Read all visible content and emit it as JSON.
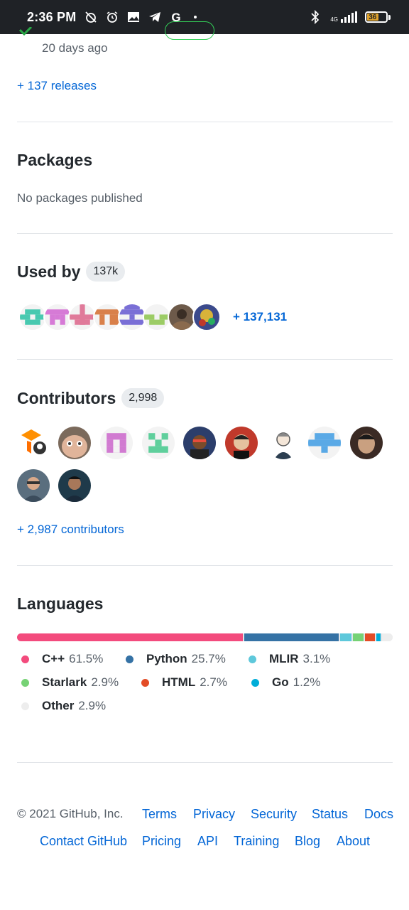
{
  "status_bar": {
    "time": "2:36 PM",
    "network": "4G",
    "battery": "36"
  },
  "releases": {
    "latest_time": "20 days ago",
    "more_link": "+ 137 releases"
  },
  "packages": {
    "title": "Packages",
    "empty_text": "No packages published"
  },
  "used_by": {
    "title": "Used by",
    "count": "137k",
    "more": "+ 137,131"
  },
  "contributors": {
    "title": "Contributors",
    "count": "2,998",
    "more": "+ 2,987 contributors"
  },
  "languages": {
    "title": "Languages",
    "items": [
      {
        "name": "C++",
        "percent": "61.5%",
        "color": "#f34b7d"
      },
      {
        "name": "Python",
        "percent": "25.7%",
        "color": "#3572A5"
      },
      {
        "name": "MLIR",
        "percent": "3.1%",
        "color": "#5EC8DB"
      },
      {
        "name": "Starlark",
        "percent": "2.9%",
        "color": "#76d275"
      },
      {
        "name": "HTML",
        "percent": "2.7%",
        "color": "#e34c26"
      },
      {
        "name": "Go",
        "percent": "1.2%",
        "color": "#00ADD8"
      },
      {
        "name": "Other",
        "percent": "2.9%",
        "color": "#ededed"
      }
    ]
  },
  "footer": {
    "copyright": "© 2021 GitHub, Inc.",
    "links": [
      "Terms",
      "Privacy",
      "Security",
      "Status",
      "Docs",
      "Contact GitHub",
      "Pricing",
      "API",
      "Training",
      "Blog",
      "About"
    ]
  }
}
